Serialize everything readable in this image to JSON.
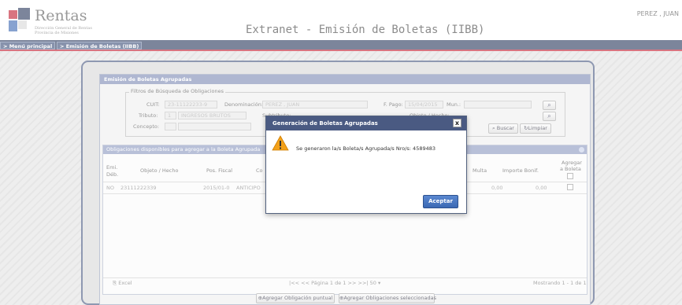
{
  "header": {
    "logo_name": "Rentas",
    "logo_sub_1": "Dirección General de Rentas",
    "logo_sub_2": "Provincia de Misiones",
    "app_title": "Extranet - Emisión de Boletas (IIBB)",
    "user": "PEREZ , JUAN"
  },
  "nav": {
    "items": [
      {
        "label": "> Menú principal"
      },
      {
        "label": "> Emisión de Boletas (IIBB)"
      }
    ]
  },
  "panel": {
    "title": "Emisión de Boletas Agrupadas",
    "filters": {
      "legend": "Filtros de Búsqueda de Obligaciones",
      "cuit_label": "CUIT:",
      "cuit_value": "23-11122233-9",
      "denominacion_label": "Denominación:",
      "denominacion_value": "PEREZ , JUAN",
      "fpago_label": "F. Pago:",
      "fpago_value": "15/04/2015",
      "mun_label": "Mun.:",
      "tributo_label": "Tributo:",
      "tributo_code": "1",
      "tributo_value": "INGRESOS BRUTOS",
      "subtributo_label": "Subtributo:",
      "objeto_label": "Objeto / Hecho:",
      "concepto_label": "Concepto:",
      "buscar_label": "Buscar",
      "limpiar_label": "Limpiar"
    }
  },
  "grid": {
    "title": "Obligaciones disponibles para agregar a la Boleta Agrupada",
    "columns": {
      "emi": "Emi.",
      "deb": "Déb.",
      "objeto": "Objeto / Hecho",
      "pos_fiscal": "Pos. Fiscal",
      "co": "Co",
      "multa": "Multa",
      "importe_bonif": "Importe Bonif.",
      "agregar_1": "Agregar",
      "agregar_2": "a Boleta"
    },
    "rows": [
      {
        "emi": "NO",
        "objeto": "23111222339",
        "pos_fiscal": "2015/01-0",
        "concepto": "ANTICIPO",
        "multa": "0,00",
        "importe_bonif": "0,00"
      }
    ],
    "excel_label": "Excel",
    "pager": {
      "first": "|<<",
      "prev": "<<",
      "page_label": "Página",
      "page_value": "1",
      "of_label": "de 1",
      "next": ">>",
      "last": ">>|",
      "per_page": "50"
    },
    "showing": "Mostrando 1 - 1 de 1"
  },
  "footer": {
    "add_single": "Agregar Obligación puntual",
    "add_selected": "Agregar Obligaciones seleccionadas"
  },
  "dialog": {
    "title": "Generación de Boletas Agrupadas",
    "close": "x",
    "message": "Se generaron la/s Boleta/s Agrupada/s Nro/s: 4589483",
    "accept": "Aceptar"
  },
  "colors": {
    "nav_bg": "#2c3b5e",
    "nav_accent": "#c21f32",
    "panel_header": "#7e8cb5",
    "dialog_header": "#4a5a82",
    "primary_button": "#3b68b3",
    "warning": "#f3a11a"
  },
  "icons": {
    "logo": "rentas-logo",
    "search": "search-icon",
    "clear": "refresh-icon",
    "excel": "excel-icon",
    "add": "plus-circle-icon",
    "warning": "warning-icon",
    "close": "close-icon"
  }
}
